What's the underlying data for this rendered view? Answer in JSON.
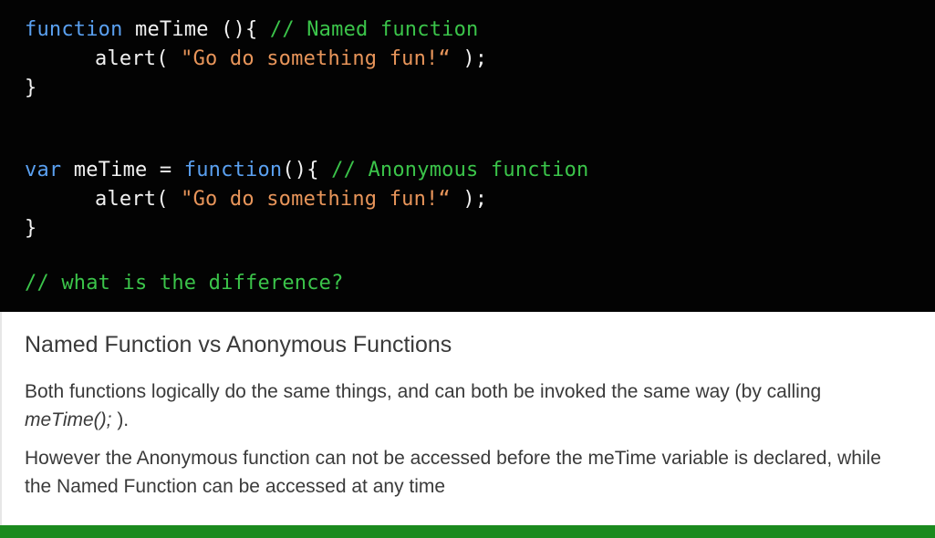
{
  "code": {
    "line1": {
      "keyword": "function",
      "rest": " meTime (){ ",
      "comment": "// Named function"
    },
    "line2": {
      "call": "alert( ",
      "string": "\"Go do something fun!“",
      "end": " );"
    },
    "line3": {
      "brace": "}"
    },
    "line4": {
      "keyword": "var",
      "middle": " meTime = ",
      "keyword2": "function",
      "rest": "(){ ",
      "comment": "// Anonymous function"
    },
    "line5": {
      "call": "alert( ",
      "string": "\"Go do something fun!“",
      "end": " );"
    },
    "line6": {
      "brace": "}"
    },
    "line7": {
      "comment": "// what is the difference?"
    }
  },
  "notes": {
    "heading": "Named Function vs Anonymous Functions",
    "paragraph1_text": "Both functions logically do the same things, and can both be invoked the same way (by calling ",
    "paragraph1_code": "meTime();",
    "paragraph1_end": " ).",
    "paragraph2": "However the Anonymous function can not be accessed before the meTime variable is declared, while the Named Function can be accessed at any time"
  },
  "colors": {
    "keyword": "#5aa0f0",
    "string": "#e8955a",
    "comment": "#3bc44a",
    "accent_bar": "#1b8a1e"
  }
}
